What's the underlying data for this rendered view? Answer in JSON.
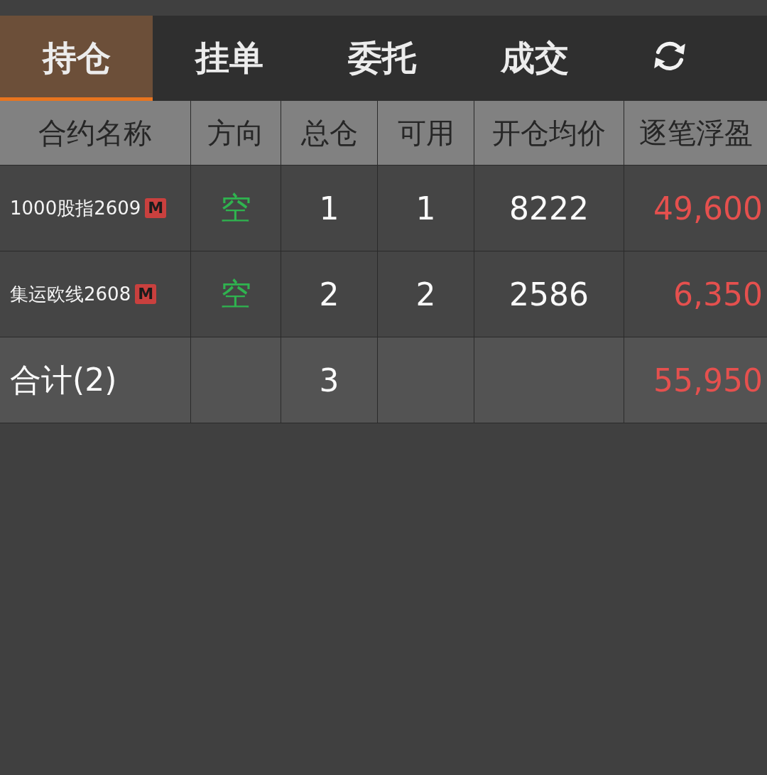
{
  "tabs": [
    {
      "label": "持仓",
      "selected": true
    },
    {
      "label": "挂单",
      "selected": false
    },
    {
      "label": "委托",
      "selected": false
    },
    {
      "label": "成交",
      "selected": false
    }
  ],
  "table": {
    "columns": [
      "合约名称",
      "方向",
      "总仓",
      "可用",
      "开仓均价",
      "逐笔浮盈"
    ],
    "rows": [
      {
        "name": "1000股指2609",
        "badge": "M",
        "direction": {
          "text": "空",
          "color": "#2fb34f"
        },
        "total": "1",
        "available": "1",
        "avg_price": "8222",
        "pnl": {
          "text": "49,600",
          "color": "#e5504e"
        }
      },
      {
        "name": "集运欧线2608",
        "badge": "M",
        "direction": {
          "text": "空",
          "color": "#2fb34f"
        },
        "total": "2",
        "available": "2",
        "avg_price": "2586",
        "pnl": {
          "text": "6,350",
          "color": "#e5504e"
        }
      }
    ],
    "summary": {
      "label": "合计(2)",
      "total": "3",
      "pnl": {
        "text": "55,950",
        "color": "#e5504e"
      }
    }
  }
}
